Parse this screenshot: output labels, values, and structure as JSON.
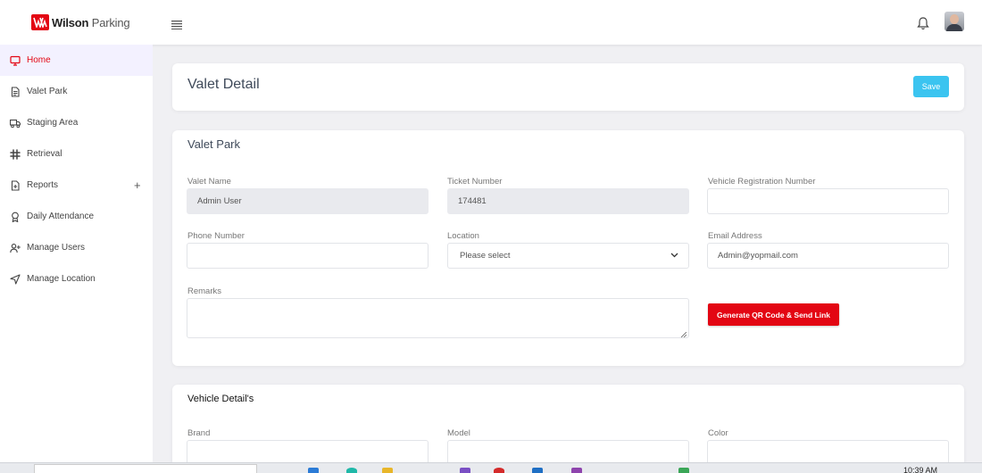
{
  "brand": {
    "name_bold": "Wilson",
    "name_light": "Parking",
    "color": "#e30613"
  },
  "header": {
    "menu_icon": "hamburger-icon",
    "notification_icon": "bell-icon",
    "avatar": "user-avatar"
  },
  "sidebar": {
    "active_color": "#e30613",
    "items": [
      {
        "label": "Home",
        "icon": "monitor-icon",
        "active": true
      },
      {
        "label": "Valet Park",
        "icon": "document-icon"
      },
      {
        "label": "Staging Area",
        "icon": "truck-icon"
      },
      {
        "label": "Retrieval",
        "icon": "slack-icon"
      },
      {
        "label": "Reports",
        "icon": "file-chart-icon",
        "expand": "+"
      },
      {
        "label": "Daily Attendance",
        "icon": "award-icon"
      },
      {
        "label": "Manage Users",
        "icon": "user-plus-icon"
      },
      {
        "label": "Manage Location",
        "icon": "navigation-icon"
      }
    ]
  },
  "page": {
    "title": "Valet Detail",
    "save_label": "Save",
    "save_color": "#3bc4f0"
  },
  "valet_park": {
    "title": "Valet Park",
    "valet_name": {
      "label": "Valet Name",
      "value": "Admin User"
    },
    "ticket_number": {
      "label": "Ticket Number",
      "value": "174481"
    },
    "vehicle_reg": {
      "label": "Vehicle Registration Number",
      "value": ""
    },
    "phone": {
      "label": "Phone Number",
      "value": ""
    },
    "location": {
      "label": "Location",
      "selected": "Please select"
    },
    "email": {
      "label": "Email Address",
      "value": "Admin@yopmail.com"
    },
    "remarks": {
      "label": "Remarks",
      "value": ""
    },
    "qr_button": "Generate QR Code & Send Link"
  },
  "vehicle_detail": {
    "title": "Vehicle Detail's",
    "brand": {
      "label": "Brand",
      "value": ""
    },
    "model": {
      "label": "Model",
      "value": ""
    },
    "color": {
      "label": "Color",
      "value": ""
    }
  },
  "taskbar": {
    "clock": "10:39 AM"
  }
}
